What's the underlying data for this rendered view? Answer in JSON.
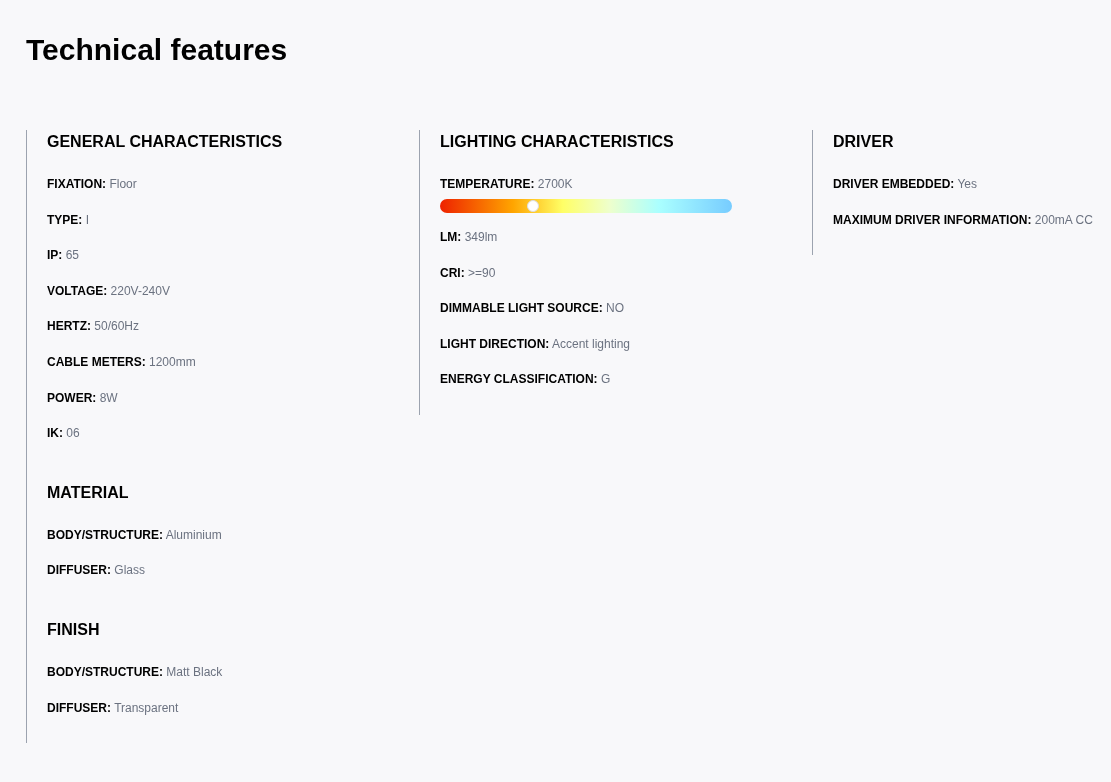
{
  "title": "Technical features",
  "columns": [
    {
      "sections": [
        {
          "heading": "GENERAL CHARACTERISTICS",
          "items": [
            {
              "kind": "text",
              "label": "FIXATION:",
              "value": "Floor"
            },
            {
              "kind": "text",
              "label": "TYPE:",
              "value": "I"
            },
            {
              "kind": "text",
              "label": "IP:",
              "value": "65"
            },
            {
              "kind": "text",
              "label": "VOLTAGE:",
              "value": "220V-240V"
            },
            {
              "kind": "text",
              "label": "HERTZ:",
              "value": "50/60Hz"
            },
            {
              "kind": "text",
              "label": "CABLE METERS:",
              "value": "1200mm"
            },
            {
              "kind": "text",
              "label": "POWER:",
              "value": "8W"
            },
            {
              "kind": "text",
              "label": "IK:",
              "value": "06"
            }
          ]
        },
        {
          "heading": "MATERIAL",
          "items": [
            {
              "kind": "text",
              "label": "BODY/STRUCTURE:",
              "value": "Aluminium"
            },
            {
              "kind": "text",
              "label": "DIFFUSER:",
              "value": "Glass"
            }
          ]
        },
        {
          "heading": "FINISH",
          "items": [
            {
              "kind": "text",
              "label": "BODY/STRUCTURE:",
              "value": "Matt Black"
            },
            {
              "kind": "text",
              "label": "DIFFUSER:",
              "value": "Transparent"
            }
          ]
        }
      ]
    },
    {
      "sections": [
        {
          "heading": "LIGHTING CHARACTERISTICS",
          "items": [
            {
              "kind": "scale",
              "label": "TEMPERATURE:",
              "value": "2700K",
              "level": 0.32
            },
            {
              "kind": "text",
              "label": "LM:",
              "value": "349lm"
            },
            {
              "kind": "text",
              "label": "CRI:",
              "value": ">=90"
            },
            {
              "kind": "text",
              "label": "DIMMABLE LIGHT SOURCE:",
              "value": "NO"
            },
            {
              "kind": "text",
              "label": "LIGHT DIRECTION:",
              "value": "Accent lighting"
            },
            {
              "kind": "text",
              "label": "ENERGY CLASSIFICATION:",
              "value": "G"
            }
          ]
        }
      ]
    },
    {
      "sections": [
        {
          "heading": "DRIVER",
          "items": [
            {
              "kind": "text",
              "label": "DRIVER EMBEDDED:",
              "value": "Yes"
            },
            {
              "kind": "text",
              "label": "MAXIMUM DRIVER INFORMATION:",
              "value": "200mA CC"
            }
          ]
        }
      ]
    }
  ]
}
